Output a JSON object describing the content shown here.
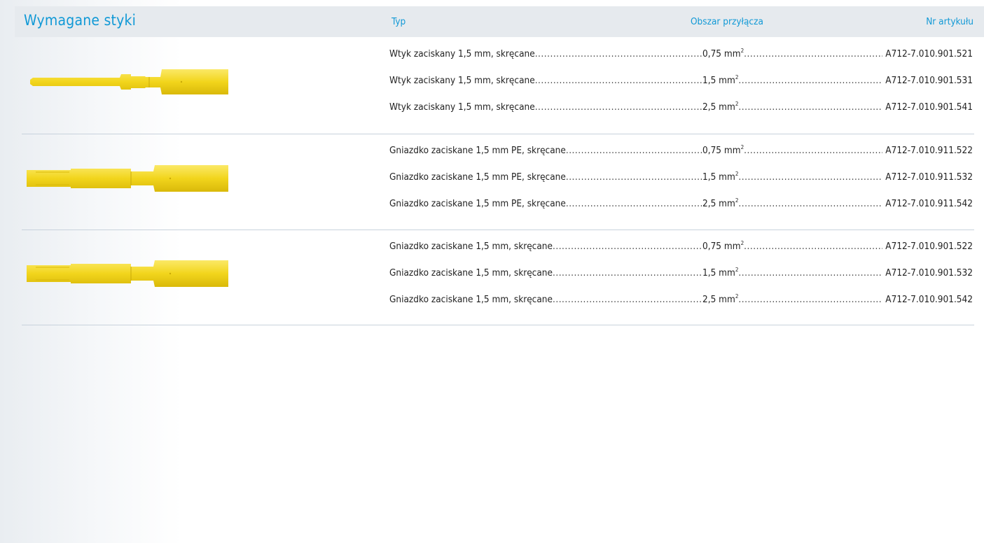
{
  "header": {
    "title": "Wymagane styki",
    "col_type": "Typ",
    "col_area": "Obszar przyłącza",
    "col_article": "Nr artykułu"
  },
  "colors": {
    "accent": "#1199d6",
    "header_bg": "#e6eaee",
    "contact_yellow": "#f2d51c"
  },
  "groups": [
    {
      "image": "crimp-pin-contact",
      "rows": [
        {
          "type": "Wtyk zaciskany 1,5 mm, skręcane",
          "area": "0,75 mm",
          "area_sup": "2",
          "article": "A712-7.010.901.521"
        },
        {
          "type": "Wtyk zaciskany 1,5 mm, skręcane",
          "area": "1,5 mm",
          "area_sup": "2",
          "article": "A712-7.010.901.531"
        },
        {
          "type": "Wtyk zaciskany 1,5 mm, skręcane",
          "area": "2,5 mm",
          "area_sup": "2",
          "article": "A712-7.010.901.541"
        }
      ]
    },
    {
      "image": "crimp-socket-contact-pe",
      "rows": [
        {
          "type": "Gniazdko zaciskane 1,5 mm PE, skręcane",
          "area": "0,75 mm",
          "area_sup": "2",
          "article": "A712-7.010.911.522"
        },
        {
          "type": "Gniazdko zaciskane  1,5 mm PE, skręcane",
          "area": "1,5 mm",
          "area_sup": "2",
          "article": "A712-7.010.911.532"
        },
        {
          "type": "Gniazdko zaciskane  1,5 mm PE, skręcane",
          "area": "2,5 mm",
          "area_sup": "2",
          "article": "A712-7.010.911.542"
        }
      ]
    },
    {
      "image": "crimp-socket-contact",
      "rows": [
        {
          "type": "Gniazdko zaciskane  1,5 mm, skręcane",
          "area": "0,75 mm",
          "area_sup": "2",
          "article": "A712-7.010.901.522"
        },
        {
          "type": "Gniazdko zaciskane  1,5 mm, skręcane",
          "area": "1,5 mm",
          "area_sup": "2",
          "article": "A712-7.010.901.532"
        },
        {
          "type": "Gniazdko zaciskane  1,5 mm, skręcane",
          "area": "2,5 mm",
          "area_sup": "2",
          "article": "A712-7.010.901.542"
        }
      ]
    }
  ]
}
